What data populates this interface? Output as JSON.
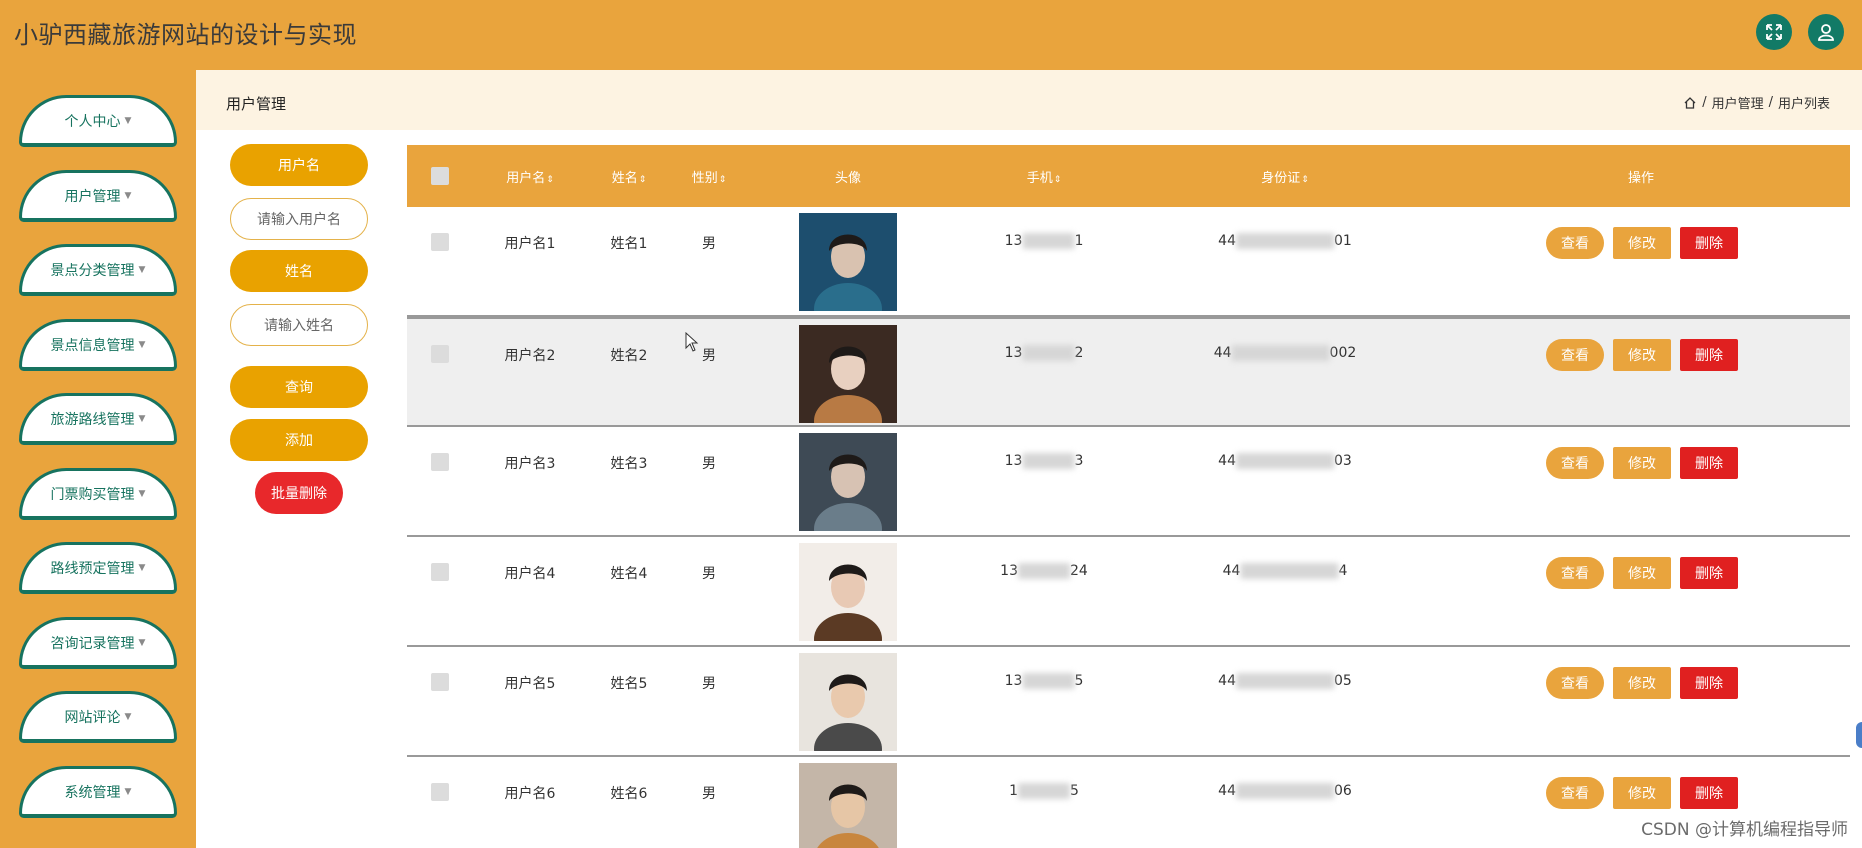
{
  "app": {
    "title": "小驴西藏旅游网站的设计与实现"
  },
  "header_icons": [
    "expand-icon",
    "user-icon"
  ],
  "sidebar": {
    "items": [
      {
        "label": "个人中心"
      },
      {
        "label": "用户管理"
      },
      {
        "label": "景点分类管理"
      },
      {
        "label": "景点信息管理"
      },
      {
        "label": "旅游路线管理"
      },
      {
        "label": "门票购买管理"
      },
      {
        "label": "路线预定管理"
      },
      {
        "label": "咨询记录管理"
      },
      {
        "label": "网站评论"
      },
      {
        "label": "系统管理"
      }
    ]
  },
  "breadcrumb": {
    "page_title": "用户管理",
    "path": [
      "用户管理",
      "用户列表"
    ],
    "separator": "/"
  },
  "search": {
    "username_label": "用户名",
    "username_placeholder": "请输入用户名",
    "name_label": "姓名",
    "name_placeholder": "请输入姓名",
    "query_button": "查询",
    "add_button": "添加",
    "batch_delete_button": "批量删除"
  },
  "table": {
    "columns": [
      "用户名",
      "姓名",
      "性别",
      "头像",
      "手机",
      "身份证",
      "操作"
    ],
    "sortable": [
      true,
      true,
      true,
      false,
      true,
      true,
      false
    ],
    "sort_glyph": "⇕",
    "rows": [
      {
        "username": "用户名1",
        "name": "姓名1",
        "gender": "男",
        "phone_prefix": "13",
        "phone_suffix": "1",
        "id_prefix": "44",
        "id_suffix": "01"
      },
      {
        "username": "用户名2",
        "name": "姓名2",
        "gender": "男",
        "phone_prefix": "13",
        "phone_suffix": "2",
        "id_prefix": "44",
        "id_suffix": "002"
      },
      {
        "username": "用户名3",
        "name": "姓名3",
        "gender": "男",
        "phone_prefix": "13",
        "phone_suffix": "3",
        "id_prefix": "44",
        "id_suffix": "03"
      },
      {
        "username": "用户名4",
        "name": "姓名4",
        "gender": "男",
        "phone_prefix": "13",
        "phone_suffix": "24",
        "id_prefix": "44",
        "id_suffix": "4"
      },
      {
        "username": "用户名5",
        "name": "姓名5",
        "gender": "男",
        "phone_prefix": "13",
        "phone_suffix": "5",
        "id_prefix": "44",
        "id_suffix": "05"
      },
      {
        "username": "用户名6",
        "name": "姓名6",
        "gender": "男",
        "phone_prefix": "1",
        "phone_suffix": "5",
        "id_prefix": "44",
        "id_suffix": "06"
      }
    ],
    "actions": {
      "view": "查看",
      "edit": "修改",
      "delete": "删除"
    }
  },
  "watermark": "CSDN @计算机编程指导师",
  "colors": {
    "header_bg": "#e9a43d",
    "accent_green": "#17735f",
    "button_orange": "#e9a200",
    "delete_red": "#e02020",
    "hover_row": "#efefef"
  }
}
